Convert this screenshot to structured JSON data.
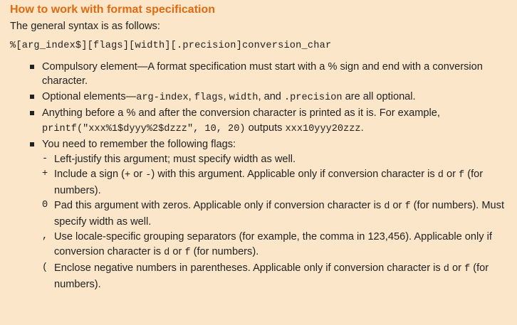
{
  "title": "How to work with format specification",
  "intro": "The general syntax is as follows:",
  "syntax": "%[arg_index$][flags][width][.precision]conversion_char",
  "bullets": [
    {
      "text": "Compulsory element—A format specification must start with a % sign and end with a conversion character."
    },
    {
      "prefix": "Optional elements—",
      "code1": "arg-index",
      "sep1": ", ",
      "code2": "flags",
      "sep2": ", ",
      "code3": "width",
      "sep3": ", and ",
      "code4": ".precision",
      "suffix": " are all optional."
    },
    {
      "prefix": "Anything before a % and after the conversion character is printed as it is. For example, ",
      "code": "printf(\"xxx%1$dyyy%2$dzzz\", 10, 20)",
      "mid": " outputs ",
      "code2": "xxx10yyy20zzz",
      "suffix": "."
    },
    {
      "text": "You need to remember the following flags:"
    }
  ],
  "flags": [
    {
      "symbol": "-",
      "text": "Left-justify this argument; must specify width as well."
    },
    {
      "symbol": "+",
      "t1": "Include a sign (",
      "c1": "+",
      "t2": " or ",
      "c2": "-",
      "t3": ") with this argument. Applicable only if conversion character is ",
      "c3": "d",
      "t4": " or ",
      "c4": "f",
      "t5": " (for numbers)."
    },
    {
      "symbol": "0",
      "t1": "Pad this argument with zeros. Applicable only if conversion character is ",
      "c1": "d",
      "t2": " or ",
      "c2": "f",
      "t3": " (for numbers). Must specify width as well."
    },
    {
      "symbol": ",",
      "t1": "Use locale-specific grouping separators (for example, the comma in 123,456). Applicable only if conversion character is ",
      "c1": "d",
      "t2": " or ",
      "c2": "f",
      "t3": " (for numbers)."
    },
    {
      "symbol": "(",
      "t1": "Enclose negative numbers in parentheses. Applicable only if conversion character is ",
      "c1": "d",
      "t2": " or ",
      "c2": "f",
      "t3": " (for numbers)."
    }
  ]
}
